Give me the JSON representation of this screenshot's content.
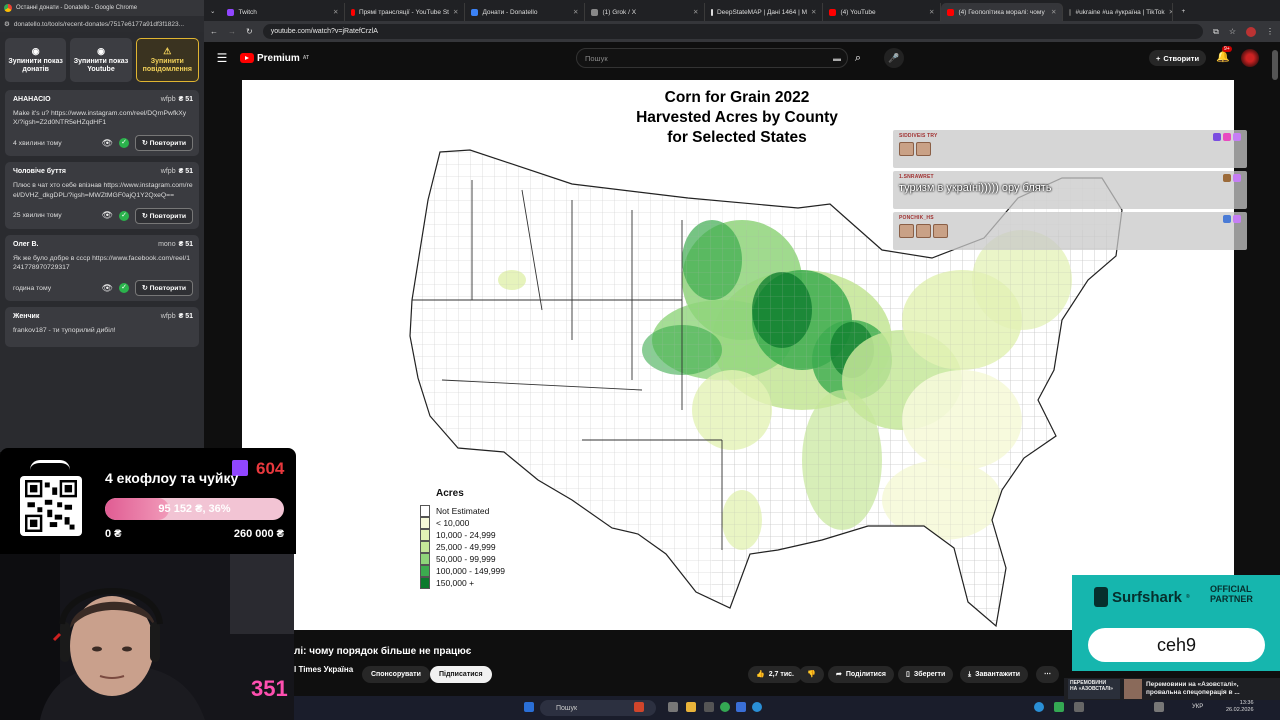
{
  "left_window": {
    "title": "Останні донати - Donatello - Google Chrome",
    "url": "donatello.to/tools/recent-donates/7517e6177a91df3f1823..."
  },
  "controls": [
    {
      "label": "Зупинити показ донатів",
      "icon": "◉"
    },
    {
      "label": "Зупинити показ Youtube",
      "icon": "◉"
    },
    {
      "label": "Зупинити повідомлення",
      "icon": "⚠"
    }
  ],
  "donations": [
    {
      "name": "АНАНАСІО",
      "source": "wfpb",
      "amount": "₴ 51",
      "message": "Make it's u? https://www.instagram.com/reel/DQrnPwfkXyX/?igsh=Z2d0NTR5eHZqdHF1",
      "time": "4 хвилини тому",
      "repeat": "Повторити"
    },
    {
      "name": "Чоловіче буття",
      "source": "wfpb",
      "amount": "₴ 51",
      "message": "Плюс в чат хто себе впізнав https://www.instagram.com/reel/DVHZ_dkgDPL/?igsh=MWZtMGF0ajQ1Y2QxeQ==",
      "time": "25 хвилин тому",
      "repeat": "Повторити"
    },
    {
      "name": "Олег В.",
      "source": "mono",
      "amount": "₴ 51",
      "message": "Як же було добре в ссср https://www.facebook.com/reel/1241778970729317",
      "time": "година тому",
      "repeat": "Повторити"
    },
    {
      "name": "Женчик",
      "source": "wfpb",
      "amount": "₴ 51",
      "message": "frankov187 - ти тупорилий дибіл!",
      "time": "",
      "repeat": ""
    }
  ],
  "tabs": [
    {
      "label": "Twitch",
      "color": "#9146ff"
    },
    {
      "label": "Прямі трансляції - YouTube St",
      "color": "#ff0000"
    },
    {
      "label": "Донати - Donatello",
      "color": "#3b82f6"
    },
    {
      "label": "(1) Grok / X",
      "color": "#888888"
    },
    {
      "label": "DeepStateMAP | Дані 1464 | М",
      "color": "#dddddd"
    },
    {
      "label": "(4) YouTube",
      "color": "#ff0000"
    },
    {
      "label": "(4) Геополітика моралі: чому",
      "color": "#ff0000"
    },
    {
      "label": "#ukraine #ua #україна | TikTok",
      "color": "#111111"
    }
  ],
  "browser": {
    "url": "youtube.com/watch?v=jRatefCrzlA"
  },
  "youtube": {
    "logo": "Premium",
    "logo_sup": "AT",
    "search_placeholder": "Пошук",
    "create_label": "Створити",
    "notifications": "9+",
    "video_title": "лі: чому порядок більше не працює",
    "channel": "l Times Україна",
    "sponsor": "Спонсорувати",
    "subscribed": "Підписатися",
    "likes": "2,7 тис.",
    "share": "Поділитися",
    "save": "Зберегти",
    "download": "Завантажити"
  },
  "map": {
    "title_lines": [
      "Corn for Grain 2022",
      "Harvested Acres by County",
      "for Selected States"
    ],
    "legend_title": "Acres",
    "legend": [
      {
        "label": "Not Estimated",
        "color": "#ffffff"
      },
      {
        "label": "< 10,000",
        "color": "#f6f9d9"
      },
      {
        "label": "10,000 - 24,999",
        "color": "#e3f2b5"
      },
      {
        "label": "25,000 - 49,999",
        "color": "#c6e79a"
      },
      {
        "label": "50,000 - 99,999",
        "color": "#8fd47a"
      },
      {
        "label": "100,000 - 149,999",
        "color": "#3cab4f"
      },
      {
        "label": "150,000 +",
        "color": "#0b7a2c"
      }
    ]
  },
  "chat": [
    {
      "user": "SIDDIVEIS TRY",
      "text": "",
      "emotes": 2
    },
    {
      "user": "1.SNRAWRET",
      "text": "туризм в україні))))) ору блять",
      "emotes": 0
    },
    {
      "user": "PONCHIK_HS",
      "text": "",
      "emotes": 3
    }
  ],
  "donate_widget": {
    "goal_title": "4 екофлоу та чуйку",
    "progress_text": "95 152 ₴, 36%",
    "progress_fraction": 0.36,
    "min": "0 ₴",
    "max": "260 000 ₴",
    "viewers": "604"
  },
  "webcam": {
    "counter": "351"
  },
  "surfshark": {
    "brand": "Surfshark",
    "partner_line1": "OFFICIAL",
    "partner_line2": "PARTNER",
    "code": "ceh9"
  },
  "taskbar": {
    "search": "Пошук",
    "lang": "УКР",
    "time": "13:36",
    "date": "26.02.2026",
    "news_line1": "Перемовини на «Азовсталі»,",
    "news_line2": "провальна спецоперація в ..."
  }
}
